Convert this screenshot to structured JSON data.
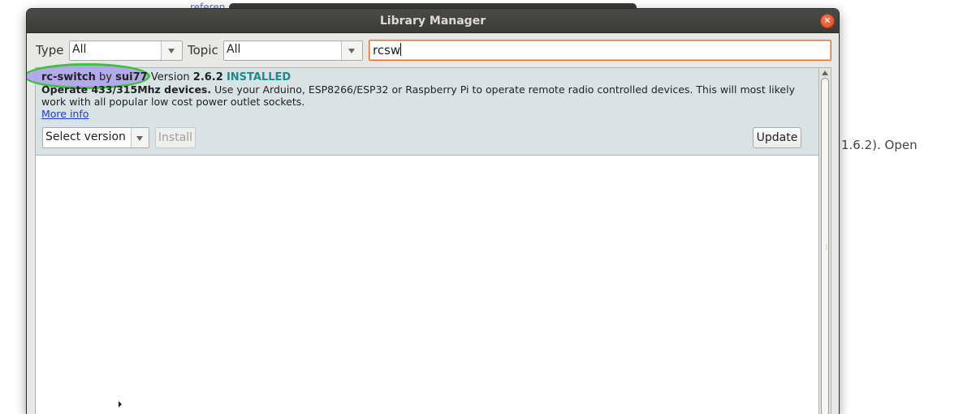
{
  "background": {
    "top_text": "referen",
    "right_text": "1.6.2). Open"
  },
  "window": {
    "title": "Library Manager",
    "close_glyph": "✕"
  },
  "filters": {
    "type_label": "Type",
    "type_value": "All",
    "topic_label": "Topic",
    "topic_value": "All",
    "search_value": "rcsw"
  },
  "library": {
    "name": "rc-switch",
    "by": "by",
    "author": "sui77",
    "version_word": "Version",
    "version": "2.6.2",
    "status": "INSTALLED",
    "desc_bold": "Operate 433/315Mhz devices.",
    "desc_text": "Use your Arduino, ESP8266/ESP32 or Raspberry Pi to operate remote radio controlled devices. This will most likely work with all popular low cost power outlet sockets.",
    "more_info": "More info",
    "select_version": "Select version",
    "install_label": "Install",
    "update_label": "Update"
  },
  "colors": {
    "installed": "#1a8c8c",
    "highlight_ring": "#39c43a",
    "highlight_fill": "#aaa0eb",
    "item_bg": "#d9e2e4",
    "search_border": "#e0702e"
  }
}
